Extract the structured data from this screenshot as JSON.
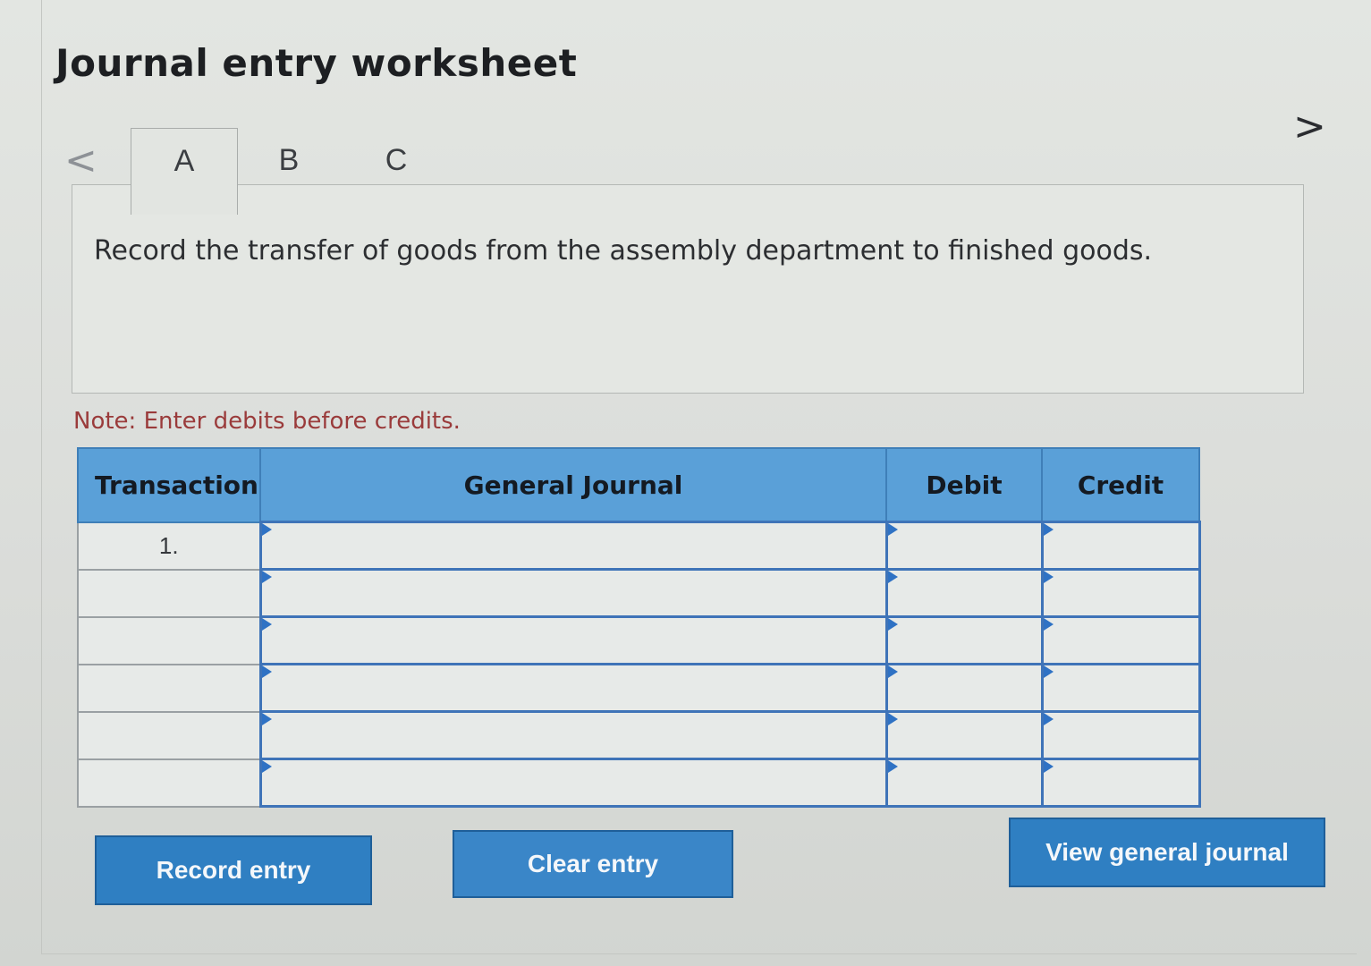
{
  "title": "Journal entry worksheet",
  "nav": {
    "prev_glyph": "<",
    "next_glyph": ">"
  },
  "tabs": [
    {
      "label": "A",
      "active": true
    },
    {
      "label": "B",
      "active": false
    },
    {
      "label": "C",
      "active": false
    }
  ],
  "instruction": "Record the transfer of goods from the assembly department to finished goods.",
  "note": "Note: Enter debits before credits.",
  "table": {
    "headers": {
      "transaction": "Transaction",
      "general_journal": "General Journal",
      "debit": "Debit",
      "credit": "Credit"
    },
    "rows": [
      {
        "transaction": "1.",
        "account": "",
        "debit": "",
        "credit": ""
      },
      {
        "transaction": "",
        "account": "",
        "debit": "",
        "credit": ""
      },
      {
        "transaction": "",
        "account": "",
        "debit": "",
        "credit": ""
      },
      {
        "transaction": "",
        "account": "",
        "debit": "",
        "credit": ""
      },
      {
        "transaction": "",
        "account": "",
        "debit": "",
        "credit": ""
      },
      {
        "transaction": "",
        "account": "",
        "debit": "",
        "credit": ""
      }
    ]
  },
  "buttons": {
    "record": "Record entry",
    "clear": "Clear entry",
    "view": "View general journal"
  },
  "colors": {
    "header_blue": "#5aa0d8",
    "button_blue": "#2f7fc2",
    "note_red": "#9a3b3b"
  }
}
